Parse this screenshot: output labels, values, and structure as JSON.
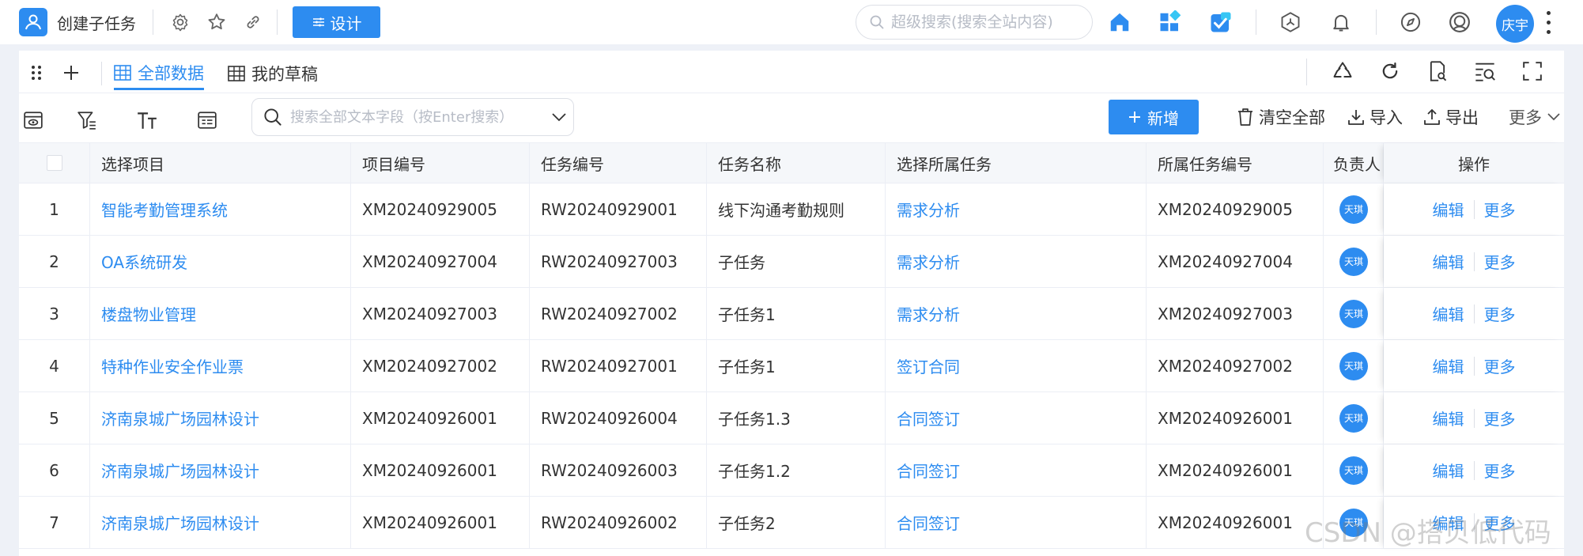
{
  "header": {
    "title": "创建子任务",
    "design_label": "设计",
    "search_placeholder": "超级搜索(搜索全站内容)",
    "user_avatar": "庆宇"
  },
  "tabs": [
    {
      "label": "全部数据",
      "active": true
    },
    {
      "label": "我的草稿",
      "active": false
    }
  ],
  "toolbar": {
    "field_search_placeholder": "搜索全部文本字段（按Enter搜索）",
    "add_label": "新增",
    "clear_label": "清空全部",
    "import_label": "导入",
    "export_label": "导出",
    "more_label": "更多"
  },
  "table": {
    "columns": [
      "选择项目",
      "项目编号",
      "任务编号",
      "任务名称",
      "选择所属任务",
      "所属任务编号",
      "负责人",
      "操作"
    ],
    "action_edit": "编辑",
    "action_more": "更多",
    "rows": [
      {
        "idx": "1",
        "project": "智能考勤管理系统",
        "project_no": "XM20240929005",
        "task_no": "RW20240929001",
        "task_name": "线下沟通考勤规则",
        "parent_task": "需求分析",
        "parent_no": "XM20240929005",
        "owner": "天琪"
      },
      {
        "idx": "2",
        "project": "OA系统研发",
        "project_no": "XM20240927004",
        "task_no": "RW20240927003",
        "task_name": "子任务",
        "parent_task": "需求分析",
        "parent_no": "XM20240927004",
        "owner": "天琪"
      },
      {
        "idx": "3",
        "project": "楼盘物业管理",
        "project_no": "XM20240927003",
        "task_no": "RW20240927002",
        "task_name": "子任务1",
        "parent_task": "需求分析",
        "parent_no": "XM20240927003",
        "owner": "天琪"
      },
      {
        "idx": "4",
        "project": "特种作业安全作业票",
        "project_no": "XM20240927002",
        "task_no": "RW20240927001",
        "task_name": "子任务1",
        "parent_task": "签订合同",
        "parent_no": "XM20240927002",
        "owner": "天琪"
      },
      {
        "idx": "5",
        "project": "济南泉城广场园林设计",
        "project_no": "XM20240926001",
        "task_no": "RW20240926004",
        "task_name": "子任务1.3",
        "parent_task": "合同签订",
        "parent_no": "XM20240926001",
        "owner": "天琪"
      },
      {
        "idx": "6",
        "project": "济南泉城广场园林设计",
        "project_no": "XM20240926001",
        "task_no": "RW20240926003",
        "task_name": "子任务1.2",
        "parent_task": "合同签订",
        "parent_no": "XM20240926001",
        "owner": "天琪"
      },
      {
        "idx": "7",
        "project": "济南泉城广场园林设计",
        "project_no": "XM20240926001",
        "task_no": "RW20240926002",
        "task_name": "子任务2",
        "parent_task": "合同签订",
        "parent_no": "XM20240926001",
        "owner": "天琪"
      }
    ]
  },
  "watermark": "CSDN @搭贝低代码",
  "colors": {
    "accent": "#2d8cf0",
    "header_bg": "#f5f7fa",
    "border": "#ebeef5"
  },
  "icons": [
    "app-user-icon",
    "gear-icon",
    "star-icon",
    "link-icon",
    "search-icon",
    "home-icon",
    "apps-icon",
    "todo-icon",
    "hexagon-icon",
    "bell-icon",
    "compass-icon",
    "headset-icon",
    "drag-handle-icon",
    "plus-icon",
    "table-icon",
    "recycle-icon",
    "refresh-icon",
    "doc-search-icon",
    "list-search-icon",
    "fullscreen-icon",
    "view-icon",
    "filter-icon",
    "text-size-icon",
    "form-icon",
    "trash-icon",
    "import-icon",
    "export-icon",
    "chevron-down-icon"
  ]
}
